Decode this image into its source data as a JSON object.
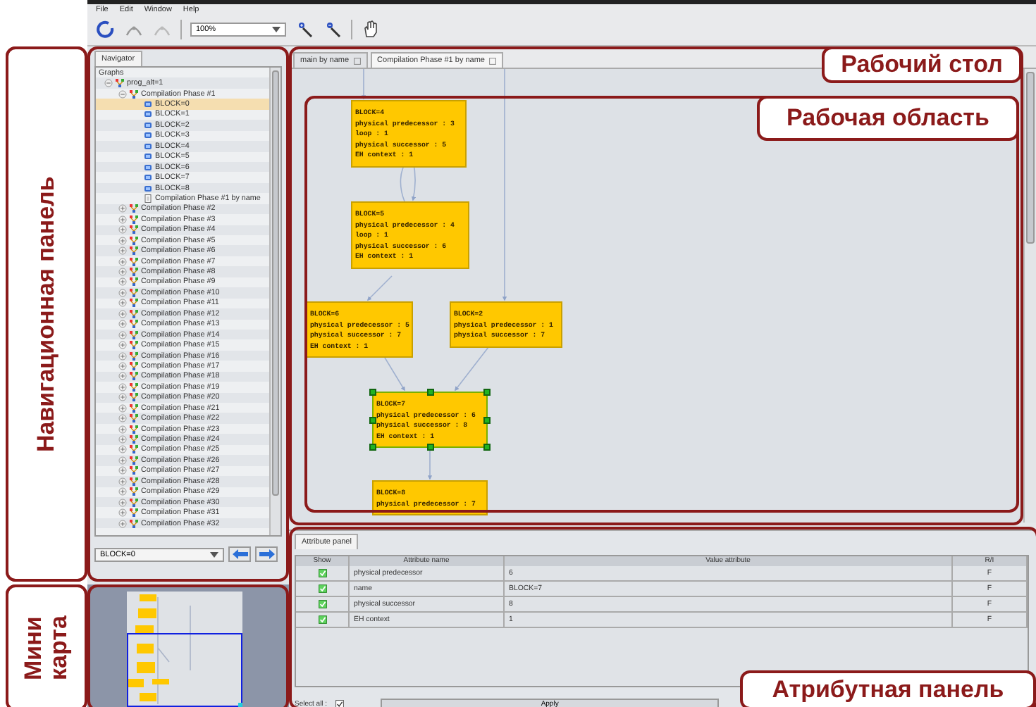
{
  "menu": [
    "File",
    "Edit",
    "Window",
    "Help"
  ],
  "toolbar": {
    "zoom": "100%"
  },
  "navigator": {
    "tab": "Navigator",
    "tree": [
      {
        "label": "Graphs",
        "selected": false,
        "children": [
          {
            "label": "prog_alt=1",
            "kind": "graph",
            "expanded": true,
            "selected": false,
            "children": [
              {
                "label": "Compilation Phase #1",
                "kind": "graph",
                "expanded": true,
                "selected": false,
                "children": [
                  {
                    "label": "BLOCK=0",
                    "kind": "block",
                    "selected": true
                  },
                  {
                    "label": "BLOCK=1",
                    "kind": "block",
                    "selected": false
                  },
                  {
                    "label": "BLOCK=2",
                    "kind": "block",
                    "selected": false
                  },
                  {
                    "label": "BLOCK=3",
                    "kind": "block",
                    "selected": false
                  },
                  {
                    "label": "BLOCK=4",
                    "kind": "block",
                    "selected": false
                  },
                  {
                    "label": "BLOCK=5",
                    "kind": "block",
                    "selected": false
                  },
                  {
                    "label": "BLOCK=6",
                    "kind": "block",
                    "selected": false
                  },
                  {
                    "label": "BLOCK=7",
                    "kind": "block",
                    "selected": false
                  },
                  {
                    "label": "BLOCK=8",
                    "kind": "block",
                    "selected": false
                  },
                  {
                    "label": "Compilation Phase #1 by name",
                    "kind": "view",
                    "selected": false
                  }
                ]
              },
              {
                "label": "Compilation Phase #2",
                "kind": "graph",
                "expanded": false,
                "selected": false
              },
              {
                "label": "Compilation Phase #3",
                "kind": "graph",
                "expanded": false,
                "selected": false
              },
              {
                "label": "Compilation Phase #4",
                "kind": "graph",
                "expanded": false,
                "selected": false
              },
              {
                "label": "Compilation Phase #5",
                "kind": "graph",
                "expanded": false,
                "selected": false
              },
              {
                "label": "Compilation Phase #6",
                "kind": "graph",
                "expanded": false,
                "selected": false
              },
              {
                "label": "Compilation Phase #7",
                "kind": "graph",
                "expanded": false,
                "selected": false
              },
              {
                "label": "Compilation Phase #8",
                "kind": "graph",
                "expanded": false,
                "selected": false
              },
              {
                "label": "Compilation Phase #9",
                "kind": "graph",
                "expanded": false,
                "selected": false
              },
              {
                "label": "Compilation Phase #10",
                "kind": "graph",
                "expanded": false,
                "selected": false
              },
              {
                "label": "Compilation Phase #11",
                "kind": "graph",
                "expanded": false,
                "selected": false
              },
              {
                "label": "Compilation Phase #12",
                "kind": "graph",
                "expanded": false,
                "selected": false
              },
              {
                "label": "Compilation Phase #13",
                "kind": "graph",
                "expanded": false,
                "selected": false
              },
              {
                "label": "Compilation Phase #14",
                "kind": "graph",
                "expanded": false,
                "selected": false
              },
              {
                "label": "Compilation Phase #15",
                "kind": "graph",
                "expanded": false,
                "selected": false
              },
              {
                "label": "Compilation Phase #16",
                "kind": "graph",
                "expanded": false,
                "selected": false
              },
              {
                "label": "Compilation Phase #17",
                "kind": "graph",
                "expanded": false,
                "selected": false
              },
              {
                "label": "Compilation Phase #18",
                "kind": "graph",
                "expanded": false,
                "selected": false
              },
              {
                "label": "Compilation Phase #19",
                "kind": "graph",
                "expanded": false,
                "selected": false
              },
              {
                "label": "Compilation Phase #20",
                "kind": "graph",
                "expanded": false,
                "selected": false
              },
              {
                "label": "Compilation Phase #21",
                "kind": "graph",
                "expanded": false,
                "selected": false
              },
              {
                "label": "Compilation Phase #22",
                "kind": "graph",
                "expanded": false,
                "selected": false
              },
              {
                "label": "Compilation Phase #23",
                "kind": "graph",
                "expanded": false,
                "selected": false
              },
              {
                "label": "Compilation Phase #24",
                "kind": "graph",
                "expanded": false,
                "selected": false
              },
              {
                "label": "Compilation Phase #25",
                "kind": "graph",
                "expanded": false,
                "selected": false
              },
              {
                "label": "Compilation Phase #26",
                "kind": "graph",
                "expanded": false,
                "selected": false
              },
              {
                "label": "Compilation Phase #27",
                "kind": "graph",
                "expanded": false,
                "selected": false
              },
              {
                "label": "Compilation Phase #28",
                "kind": "graph",
                "expanded": false,
                "selected": false
              },
              {
                "label": "Compilation Phase #29",
                "kind": "graph",
                "expanded": false,
                "selected": false
              },
              {
                "label": "Compilation Phase #30",
                "kind": "graph",
                "expanded": false,
                "selected": false
              },
              {
                "label": "Compilation Phase #31",
                "kind": "graph",
                "expanded": false,
                "selected": false
              },
              {
                "label": "Compilation Phase #32",
                "kind": "graph",
                "expanded": false,
                "selected": false
              }
            ]
          }
        ]
      }
    ],
    "combo": "BLOCK=0"
  },
  "tabs": [
    {
      "label": "main by name",
      "selected": false
    },
    {
      "label": "Compilation Phase #1 by name",
      "selected": true
    }
  ],
  "graph": {
    "nodes": [
      {
        "title": "BLOCK=4",
        "lines": [
          "physical predecessor : 3",
          "loop : 1",
          "physical successor : 5",
          "EH context : 1"
        ],
        "selected": false
      },
      {
        "title": "BLOCK=5",
        "lines": [
          "physical predecessor : 4",
          "loop : 1",
          "physical successor : 6",
          "EH context : 1"
        ],
        "selected": false
      },
      {
        "title": "BLOCK=6",
        "lines": [
          "physical predecessor : 5",
          "physical successor : 7",
          "EH context : 1"
        ],
        "selected": false
      },
      {
        "title": "BLOCK=2",
        "lines": [
          "physical predecessor : 1",
          "physical successor : 7"
        ],
        "selected": false
      },
      {
        "title": "BLOCK=7",
        "lines": [
          "physical predecessor : 6",
          "physical successor : 8",
          "EH context : 1"
        ],
        "selected": true
      },
      {
        "title": "BLOCK=8",
        "lines": [
          "physical predecessor : 7"
        ],
        "selected": false
      }
    ]
  },
  "attribute_panel": {
    "tab": "Attribute panel",
    "columns": [
      "Show",
      "Attribute name",
      "Value attribute",
      "R/I"
    ],
    "rows": [
      {
        "checked": true,
        "name": "physical predecessor",
        "value": "6",
        "flag": "F"
      },
      {
        "checked": true,
        "name": "name",
        "value": "BLOCK=7",
        "flag": "F"
      },
      {
        "checked": true,
        "name": "physical successor",
        "value": "8",
        "flag": "F"
      },
      {
        "checked": true,
        "name": "EH context",
        "value": "1",
        "flag": "F"
      }
    ],
    "select_all_label": "Select all :",
    "select_all": true,
    "apply": "Apply"
  },
  "annotations": [
    {
      "label": "Навигационная панель"
    },
    {
      "label": "Мини карта"
    },
    {
      "label": "Рабочий стол"
    },
    {
      "label": "Рабочая область"
    },
    {
      "label": "Атрибутная панель"
    }
  ]
}
